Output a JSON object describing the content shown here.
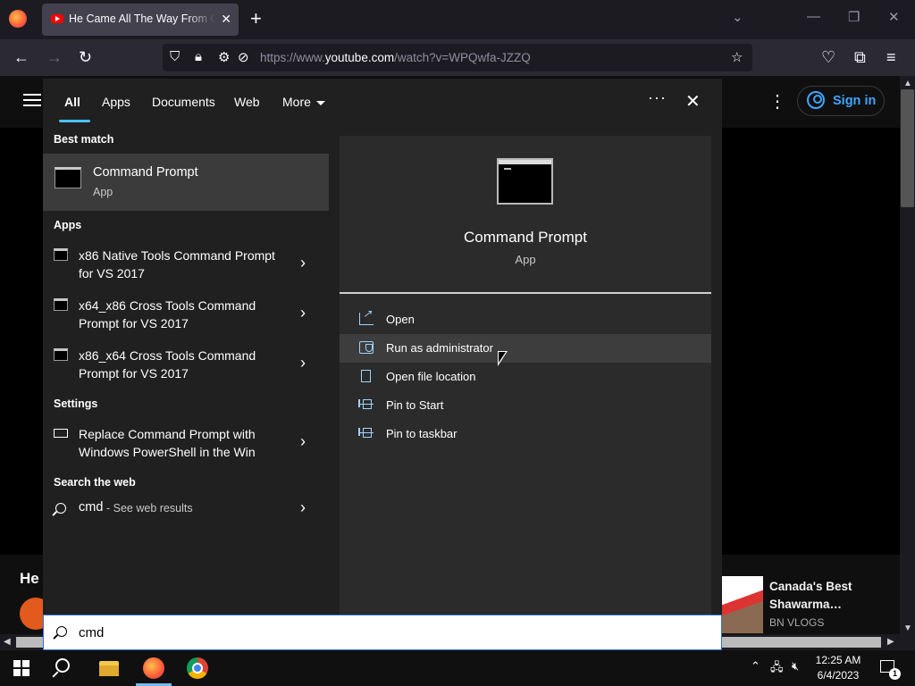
{
  "browser": {
    "tab_title": "He Came All The Way From Ca",
    "url_prefix": "https://www.",
    "url_domain": "youtube.com",
    "url_path": "/watch?v=WPQwfa-JZZQ"
  },
  "youtube": {
    "sign_in": "Sign in",
    "title_fragment": "He",
    "recommended": {
      "title": "Canada's Best Shawarma…",
      "channel": "BN VLOGS"
    }
  },
  "search_panel": {
    "tabs": [
      "All",
      "Apps",
      "Documents",
      "Web",
      "More"
    ],
    "best_match_heading": "Best match",
    "best_match": {
      "name": "Command Prompt",
      "kind": "App"
    },
    "apps_heading": "Apps",
    "apps": [
      "x86 Native Tools Command Prompt for VS 2017",
      "x64_x86 Cross Tools Command Prompt for VS 2017",
      "x86_x64 Cross Tools Command Prompt for VS 2017"
    ],
    "settings_heading": "Settings",
    "settings": [
      "Replace Command Prompt with Windows PowerShell in the Win"
    ],
    "web_heading": "Search the web",
    "web_query": "cmd",
    "web_suffix": "- See web results",
    "detail": {
      "name": "Command Prompt",
      "kind": "App",
      "actions": [
        "Open",
        "Run as administrator",
        "Open file location",
        "Pin to Start",
        "Pin to taskbar"
      ]
    },
    "query": "cmd"
  },
  "taskbar": {
    "time": "12:25 AM",
    "date": "6/4/2023",
    "notification_count": "1"
  },
  "colors": {
    "accent": "#4cc2ff",
    "selected_row": "#3b3b3b",
    "panel_bg": "#202020",
    "detail_bg": "#2b2b2b",
    "yt_link": "#3ea6ff"
  }
}
